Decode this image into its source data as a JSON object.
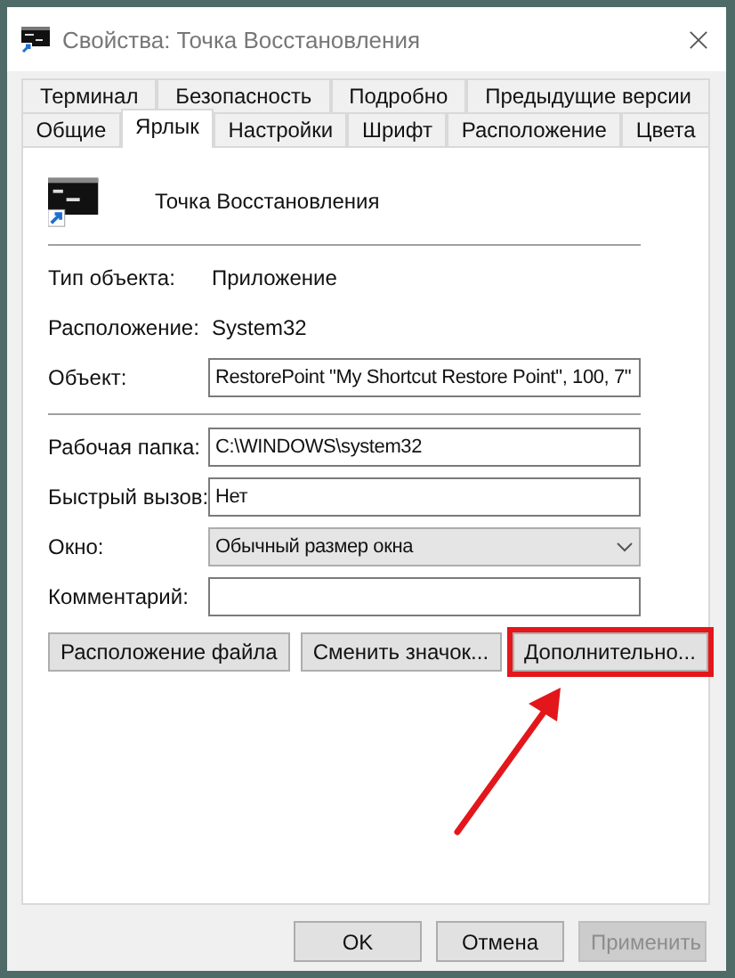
{
  "window": {
    "title": "Свойства: Точка Восстановления"
  },
  "tab_rows": [
    {
      "tabs": [
        {
          "label": "Терминал",
          "selected": false
        },
        {
          "label": "Безопасность",
          "selected": false
        },
        {
          "label": "Подробно",
          "selected": false
        },
        {
          "label": "Предыдущие версии",
          "selected": false
        }
      ]
    },
    {
      "tabs": [
        {
          "label": "Общие",
          "selected": false
        },
        {
          "label": "Ярлык",
          "selected": true
        },
        {
          "label": "Настройки",
          "selected": false
        },
        {
          "label": "Шрифт",
          "selected": false
        },
        {
          "label": "Расположение",
          "selected": false
        },
        {
          "label": "Цвета",
          "selected": false
        }
      ]
    }
  ],
  "shortcut": {
    "name": "Точка Восстановления"
  },
  "sections": [
    [
      {
        "kind": "info",
        "label": "Тип объекта:",
        "value": "Приложение"
      },
      {
        "kind": "info",
        "label": "Расположение:",
        "value": "System32"
      },
      {
        "kind": "field",
        "label": "Объект:",
        "value": "RestorePoint \"My Shortcut Restore Point\", 100, 7\""
      }
    ],
    [
      {
        "kind": "field",
        "label": "Рабочая папка:",
        "value": "C:\\WINDOWS\\system32"
      },
      {
        "kind": "field",
        "label": "Быстрый вызов:",
        "value": "Нет"
      },
      {
        "kind": "select",
        "label": "Окно:",
        "value": "Обычный размер окна"
      },
      {
        "kind": "field",
        "label": "Комментарий:"
      }
    ]
  ],
  "buttons": [
    {
      "label": "Расположение файла",
      "highlighted": false
    },
    {
      "label": "Сменить значок...",
      "highlighted": false
    },
    {
      "label": "Дополнительно...",
      "highlighted": true
    }
  ],
  "footer_buttons": [
    {
      "label": "OK",
      "disabled": false
    },
    {
      "label": "Отмена",
      "disabled": false
    },
    {
      "label": "Применить",
      "disabled": true
    }
  ]
}
